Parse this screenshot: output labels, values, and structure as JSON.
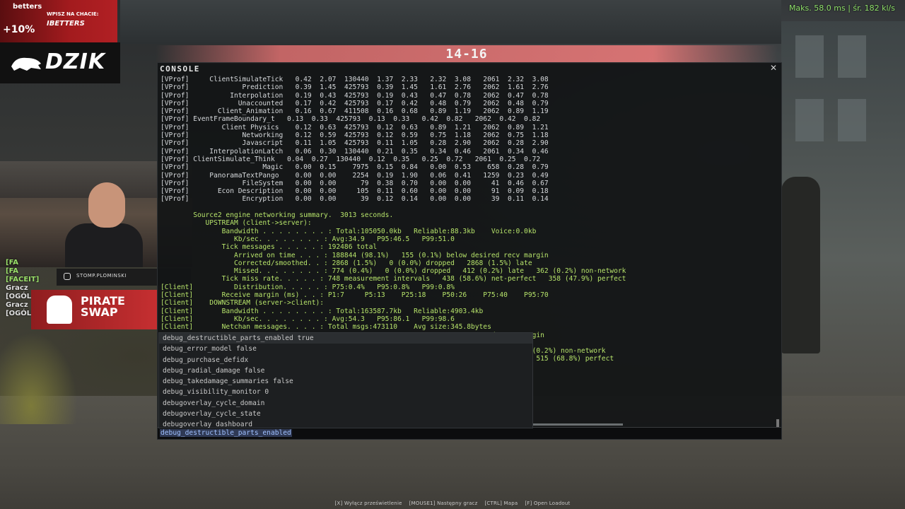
{
  "net_stats": "Maks. 58.0 ms | śr. 182 kl/s",
  "score": "14-16",
  "sponsor": {
    "brand": "betters",
    "chat_prompt": "WPISZ NA CHACIE:",
    "code": "IBETTERS",
    "promo": "+10%",
    "logo": "DZIK"
  },
  "stream": {
    "social_handle": "STOMP.PLOMINSKI",
    "pirate_line1": "PIRATE",
    "pirate_line2": "SWAP"
  },
  "chat": [
    {
      "text": "[FA",
      "color": "green"
    },
    {
      "text": "[FA",
      "color": "green"
    },
    {
      "text": "[FACEIT]",
      "color": "green"
    },
    {
      "text": "Gracz",
      "color": "white"
    },
    {
      "text": "[OGÓL",
      "color": "white"
    },
    {
      "text": "Gracz",
      "color": "white"
    },
    {
      "text": "[OGÓLNY]",
      "color": "white"
    }
  ],
  "console": {
    "title": "CONSOLE",
    "close_icon": "close-icon",
    "lines": [
      {
        "text": "[VProf]     ClientSimulateTick   0.42  2.07  130440  1.37  2.33   2.32  3.08   2061  2.32  3.08",
        "kind": "vprof"
      },
      {
        "text": "[VProf]             Prediction   0.39  1.45  425793  0.39  1.45   1.61  2.76   2062  1.61  2.76",
        "kind": "vprof"
      },
      {
        "text": "[VProf]          Interpolation   0.19  0.43  425793  0.19  0.43   0.47  0.78   2062  0.47  0.78",
        "kind": "vprof"
      },
      {
        "text": "[VProf]            Unaccounted   0.17  0.42  425793  0.17  0.42   0.48  0.79   2062  0.48  0.79",
        "kind": "vprof"
      },
      {
        "text": "[VProf]       Client_Animation   0.16  0.67  411508  0.16  0.68   0.89  1.19   2062  0.89  1.19",
        "kind": "vprof"
      },
      {
        "text": "[VProf] EventFrameBoundary_t   0.13  0.33  425793  0.13  0.33   0.42  0.82   2062  0.42  0.82",
        "kind": "vprof"
      },
      {
        "text": "[VProf]        Client Physics    0.12  0.63  425793  0.12  0.63   0.89  1.21   2062  0.89  1.21",
        "kind": "vprof"
      },
      {
        "text": "[VProf]             Networking   0.12  0.59  425793  0.12  0.59   0.75  1.18   2062  0.75  1.18",
        "kind": "vprof"
      },
      {
        "text": "[VProf]             Javascript   0.11  1.05  425793  0.11  1.05   0.28  2.90   2062  0.28  2.90",
        "kind": "vprof"
      },
      {
        "text": "[VProf]     InterpolationLatch   0.06  0.30  130440  0.21  0.35   0.34  0.46   2061  0.34  0.46",
        "kind": "vprof"
      },
      {
        "text": "[VProf] ClientSimulate_Think   0.04  0.27  130440  0.12  0.35   0.25  0.72   2061  0.25  0.72",
        "kind": "vprof"
      },
      {
        "text": "[VProf]                  Magic   0.00  0.15    7975  0.15  0.84   0.00  0.53    658  0.28  0.79",
        "kind": "vprof"
      },
      {
        "text": "[VProf]     PanoramaTextPango    0.00  0.00    2254  0.19  1.90   0.06  0.41   1259  0.23  0.49",
        "kind": "vprof"
      },
      {
        "text": "[VProf]             FileSystem   0.00  0.00      79  0.38  0.70   0.00  0.00     41  0.46  0.67",
        "kind": "vprof"
      },
      {
        "text": "[VProf]       Econ Description   0.00  0.00     105  0.11  0.60   0.00  0.00     91  0.09  0.18",
        "kind": "vprof"
      },
      {
        "text": "[VProf]             Encryption   0.00  0.00      39  0.12  0.14   0.00  0.00     39  0.11  0.14",
        "kind": "vprof"
      },
      {
        "text": "",
        "kind": "green"
      },
      {
        "text": "        Source2 engine networking summary.  3013 seconds.",
        "kind": "green"
      },
      {
        "text": "           UPSTREAM (client->server):",
        "kind": "green"
      },
      {
        "text": "               Bandwidth . . . . . . . . : Total:105050.0kb   Reliable:88.3kb    Voice:0.0kb",
        "kind": "green"
      },
      {
        "text": "                  Kb/sec. . . . . . . . : Avg:34.9   P95:46.5   P99:51.0",
        "kind": "green"
      },
      {
        "text": "               Tick messages . . . . . : 192486 total",
        "kind": "green"
      },
      {
        "text": "                  Arrived on time . . . : 188844 (98.1%)   155 (0.1%) below desired recv margin",
        "kind": "green"
      },
      {
        "text": "                  Corrected/smoothed. . : 2868 (1.5%)   0 (0.0%) dropped   2868 (1.5%) late",
        "kind": "green"
      },
      {
        "text": "                  Missed. . . . . . . . : 774 (0.4%)   0 (0.0%) dropped   412 (0.2%) late   362 (0.2%) non-network",
        "kind": "green"
      },
      {
        "text": "               Tick miss rate. . . . . : 748 measurement intervals   438 (58.6%) net-perfect   358 (47.9%) perfect",
        "kind": "green"
      },
      {
        "text": "[Client]          Distribution. . . . . : P75:0.4%   P95:0.8%   P99:0.8%",
        "kind": "green"
      },
      {
        "text": "[Client]       Receive margin (ms) . . : P1:7     P5:13    P25:18    P50:26    P75:40    P95:70",
        "kind": "green"
      },
      {
        "text": "[Client]    DOWNSTREAM (server->client):",
        "kind": "green"
      },
      {
        "text": "[Client]       Bandwidth . . . . . . . . : Total:163587.7kb   Reliable:4903.4kb",
        "kind": "green"
      },
      {
        "text": "[Client]          Kb/sec. . . . . . . . : Avg:54.3   P95:86.1   P99:98.6",
        "kind": "green"
      },
      {
        "text": "[Client]       Netchan messages. . . . : Total msgs:473110    Avg size:345.8bytes",
        "kind": "green"
      },
      {
        "text": "                                                                                ed recv margin",
        "kind": "green"
      },
      {
        "text": "                                                                                e",
        "kind": "green"
      },
      {
        "text": "                                                                                late   308 (0.2%) non-network",
        "kind": "green"
      },
      {
        "text": "                                                                                t-perfect   515 (68.8%) perfect",
        "kind": "green"
      },
      {
        "text": "",
        "kind": "green"
      },
      {
        "text": "                                                                                7",
        "kind": "green"
      }
    ],
    "autocomplete": [
      "debug_destructible_parts_enabled true",
      "debug_error_model false",
      "debug_purchase_defidx",
      "debug_radial_damage false",
      "debug_takedamage_summaries false",
      "debug_visibility_monitor 0",
      "debugoverlay_cycle_domain",
      "debugoverlay_cycle_state",
      "debugoverlay_dashboard"
    ],
    "input_value": "debug_destructible_parts_enabled"
  },
  "hints": [
    "[X] Wyłącz prześwietlenie",
    "[MOUSE1] Następny gracz",
    "[CTRL] Mapa",
    "[F] Open Loadout"
  ]
}
